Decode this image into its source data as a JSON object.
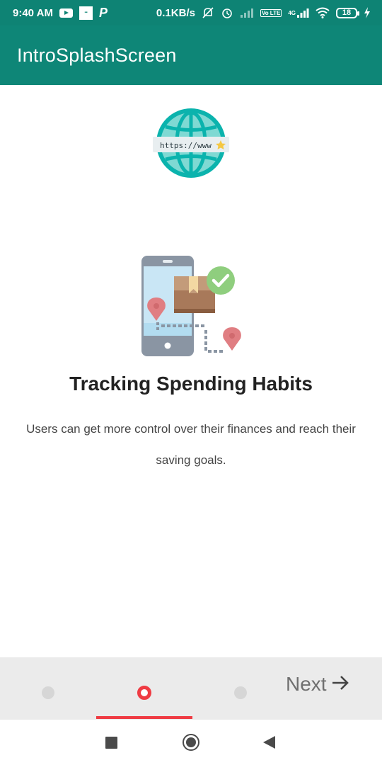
{
  "status_bar": {
    "time": "9:40 AM",
    "network_speed": "0.1KB/s",
    "battery_level": "18",
    "volte_label": "Vo LTE",
    "network_type": "4G",
    "icons": [
      "youtube-icon",
      "app-icon",
      "p-app-icon",
      "mute-icon",
      "alarm-icon",
      "signal-icon",
      "wifi-icon",
      "battery-icon",
      "charging-icon"
    ]
  },
  "app_bar": {
    "title": "IntroSplashScreen"
  },
  "header_logo": {
    "url_text": "https://www"
  },
  "slide": {
    "title": "Tracking Spending Habits",
    "description": "Users can get more control over their finances and reach their saving goals."
  },
  "pager": {
    "page_count": 3,
    "current_page": 2,
    "next_label": "Next"
  },
  "colors": {
    "primary": "#0e8677",
    "accent": "#ef3b43",
    "tab_background": "#ebebeb"
  }
}
